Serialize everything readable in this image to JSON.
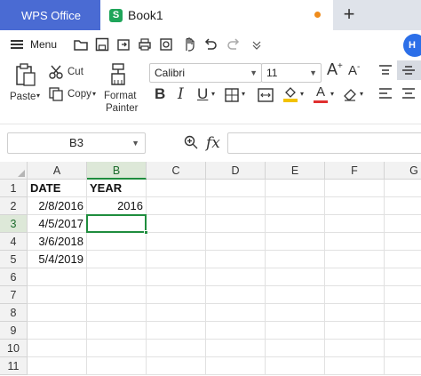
{
  "tabs": {
    "home_tab": "WPS Office",
    "doc_tab": "Book1",
    "sheet_icon_letter": "S",
    "new_tab_symbol": "+"
  },
  "menu": {
    "label": "Menu",
    "quick_icons": [
      "open-folder-icon",
      "save-icon",
      "export-icon",
      "print-icon",
      "print-preview-icon",
      "format-painter-hand-icon",
      "undo-icon",
      "redo-icon",
      "customize-dropdown-icon"
    ],
    "avatar_text": "H"
  },
  "ribbon": {
    "paste_label": "Paste",
    "cut_label": "Cut",
    "copy_label": "Copy",
    "format_painter_label_1": "Format",
    "format_painter_label_2": "Painter",
    "font_name": "Calibri",
    "font_size": "11",
    "accent_color": "#1f8d3e",
    "font_color_bar": "#e03030",
    "highlight_color_bar": "#f2c200"
  },
  "formula_bar": {
    "name_box": "B3",
    "fx": "fx",
    "formula": ""
  },
  "sheet": {
    "columns": [
      "A",
      "B",
      "C",
      "D",
      "E",
      "F",
      "G"
    ],
    "rows": [
      "1",
      "2",
      "3",
      "4",
      "5",
      "6",
      "7",
      "8",
      "9",
      "10",
      "11"
    ],
    "selected_cell": "B3",
    "cells": {
      "A1": "DATE",
      "B1": "YEAR",
      "A2": "2/8/2016",
      "B2": "2016",
      "A3": "4/5/2017",
      "A4": "3/6/2018",
      "A5": "5/4/2019"
    }
  }
}
